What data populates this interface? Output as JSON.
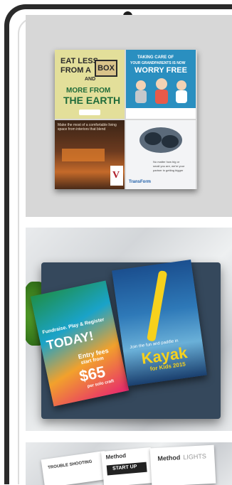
{
  "tile1": {
    "card_ecobox": {
      "line1": "EAT LESS",
      "line2": "FROM A",
      "boxword": "BOX",
      "and": "AND",
      "line3": "MORE FROM",
      "line4": "THE EARTH"
    },
    "card_grandparents": {
      "line1": "TAKING CARE OF",
      "line2": "YOUR GRANDPARENTS IS NOW",
      "line3": "WORRY FREE"
    },
    "card_interior": {
      "caption": "Make the most of a comfortable living space from interiors that blend",
      "brand": "V"
    },
    "card_business": {
      "caption1": "No matter how big or",
      "caption2": "small you are, we're your",
      "caption3": "partner in getting bigger",
      "brand": "TransForm"
    }
  },
  "tile2": {
    "flyer_left": {
      "heading": "Fundraise. Play & Register",
      "today": "TODAY!",
      "entry": "Entry fees",
      "start": "start from",
      "price": "$65",
      "per": "per solo craft"
    },
    "flyer_right": {
      "join": "Join the fun and paddle in",
      "kayak": "Kayak",
      "year": "for Kids 2015"
    }
  },
  "tile3": {
    "brand1": "Method",
    "brand2": "LIGHTS",
    "startup": "START UP",
    "trouble": "TROUBLE SHOOTING"
  },
  "colors": {
    "frame": "#2b2b2b",
    "eco_bg": "#e3df9a",
    "eco_green": "#1f6b3a",
    "grand_bg": "#2a8fc0",
    "flyer_orange": "#f2a12c",
    "flyer_pink": "#e7266f",
    "kayak_yellow": "#f6d11d"
  }
}
